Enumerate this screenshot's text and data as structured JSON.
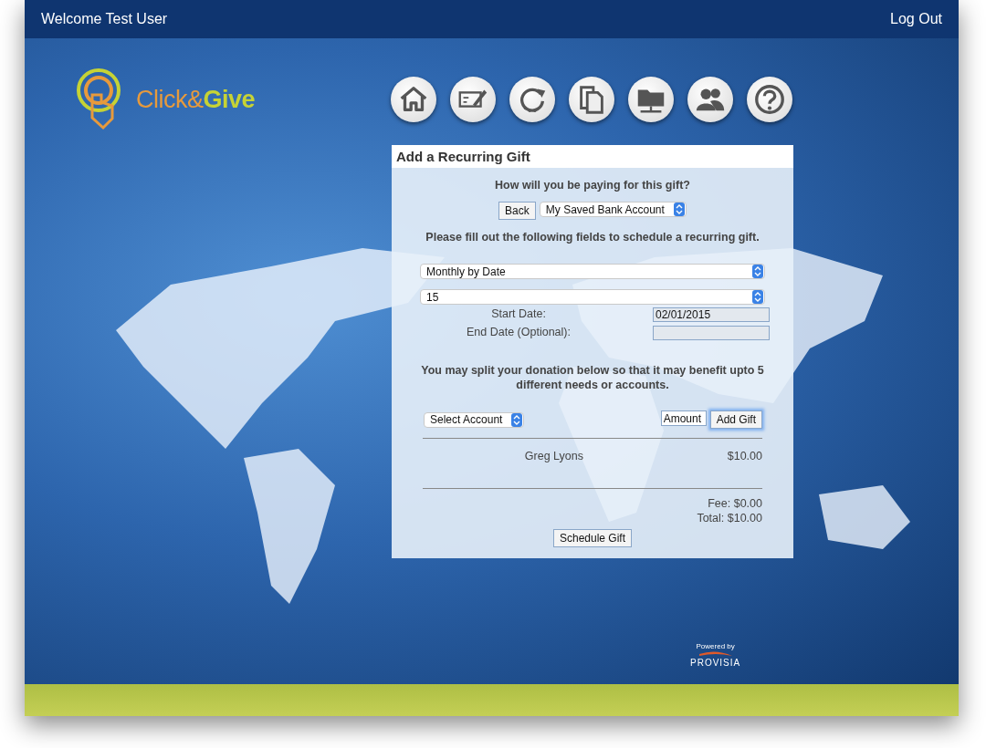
{
  "top_bar": {
    "welcome": "Welcome Test User",
    "logout": "Log Out"
  },
  "logo": {
    "part1": "Click&",
    "part2": "Give"
  },
  "nav_buttons": [
    {
      "kind": "home"
    },
    {
      "kind": "check"
    },
    {
      "kind": "recurring"
    },
    {
      "kind": "copy"
    },
    {
      "kind": "folder"
    },
    {
      "kind": "people"
    },
    {
      "kind": "help"
    }
  ],
  "panel": {
    "title": "Add a Recurring Gift",
    "payment_question": "How will you be paying for this gift?",
    "back_button": "Back",
    "payment_select": "My Saved Bank Account",
    "instructions": "Please fill out the following fields to schedule a recurring gift.",
    "frequency_select": "Monthly by Date",
    "day_select": "15",
    "start_date_label": "Start Date:",
    "start_date_value": "02/01/2015",
    "end_date_label": "End Date (Optional):",
    "split_note": "You may split your donation below so that it may benefit upto 5 different needs or accounts.",
    "account_select": "Select Account",
    "amount_placeholder": "Amount",
    "add_gift_button": "Add Gift",
    "gifts": [
      {
        "name": "Greg Lyons",
        "amount": "$10.00"
      }
    ],
    "fee": "Fee: $0.00",
    "total": "Total: $10.00",
    "schedule_button": "Schedule Gift"
  },
  "footer": {
    "powered_by": "Powered by",
    "brand": "PROVISIA"
  }
}
